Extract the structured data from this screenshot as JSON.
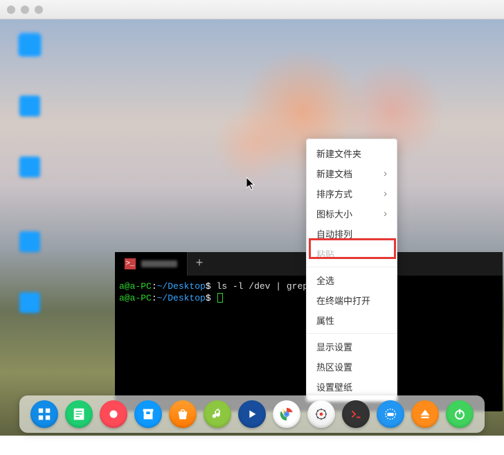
{
  "titlebar": {
    "title": ""
  },
  "desktop_icons": [
    {
      "name": "icon-1"
    },
    {
      "name": "icon-2"
    },
    {
      "name": "icon-3"
    },
    {
      "name": "icon-4"
    },
    {
      "name": "icon-5"
    }
  ],
  "terminal": {
    "tab_add": "+",
    "lines": [
      {
        "user": "a@a-PC",
        "sep1": ":",
        "path": "~/Desktop",
        "sep2": "$",
        "cmd": " ls -l /dev | grep"
      },
      {
        "user": "a@a-PC",
        "sep1": ":",
        "path": "~/Desktop",
        "sep2": "$",
        "cmd": ""
      }
    ]
  },
  "context_menu": {
    "items": [
      {
        "label": "新建文件夹",
        "submenu": false,
        "disabled": false
      },
      {
        "label": "新建文档",
        "submenu": true,
        "disabled": false
      },
      {
        "label": "排序方式",
        "submenu": true,
        "disabled": false
      },
      {
        "label": "图标大小",
        "submenu": true,
        "disabled": false
      },
      {
        "label": "自动排列",
        "submenu": false,
        "disabled": false
      },
      {
        "label": "粘贴",
        "submenu": false,
        "disabled": true
      },
      {
        "label": "全选",
        "submenu": false,
        "disabled": false,
        "sep_before": true
      },
      {
        "label": "在终端中打开",
        "submenu": false,
        "disabled": false,
        "highlight": true
      },
      {
        "label": "属性",
        "submenu": false,
        "disabled": false
      },
      {
        "label": "显示设置",
        "submenu": false,
        "disabled": false,
        "sep_before": true
      },
      {
        "label": "热区设置",
        "submenu": false,
        "disabled": false
      },
      {
        "label": "设置壁纸",
        "submenu": false,
        "disabled": false
      }
    ]
  },
  "dock": {
    "items": [
      {
        "name": "launcher"
      },
      {
        "name": "file-manager"
      },
      {
        "name": "screen-recorder"
      },
      {
        "name": "app-store"
      },
      {
        "name": "software-center"
      },
      {
        "name": "music"
      },
      {
        "name": "video-player"
      },
      {
        "name": "chrome"
      },
      {
        "name": "settings"
      },
      {
        "name": "terminal"
      },
      {
        "name": "keyboard"
      },
      {
        "name": "removable-media"
      },
      {
        "name": "power"
      }
    ]
  }
}
